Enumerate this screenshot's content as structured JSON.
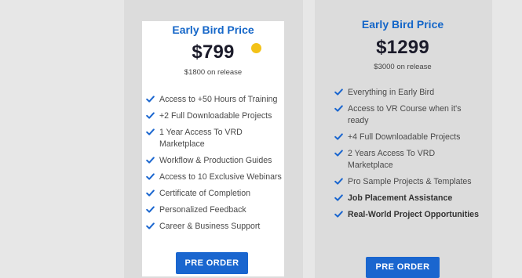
{
  "cards": [
    {
      "title": "Early Bird Price",
      "price": "$799",
      "subtitle": "$1800 on release",
      "features": [
        "Access to +50 Hours of Training",
        "+2 Full Downloadable Projects",
        "1 Year Access To VRD Marketplace",
        "Workflow & Production Guides",
        "Access to 10 Exclusive Webinars",
        "Certificate of Completion",
        "Personalized Feedback",
        "Career & Business Support"
      ],
      "button_label": "PRE ORDER"
    },
    {
      "title": "Early Bird Price",
      "price": "$1299",
      "subtitle": "$3000 on release",
      "features": [
        "Everything in Early Bird",
        "Access to VR Course when it's ready",
        "+4 Full Downloadable Projects",
        "2 Years Access To VRD Marketplace",
        "Pro Sample Projects & Templates",
        "Job Placement Assistance",
        "Real-World Project Opportunities"
      ],
      "button_label": "PRE ORDER"
    }
  ],
  "colors": {
    "accent": "#1466c8",
    "button": "#1a66cf",
    "check": "#1a66cf",
    "dot": "#f3c218"
  },
  "icons": {
    "feature": "check-icon"
  }
}
